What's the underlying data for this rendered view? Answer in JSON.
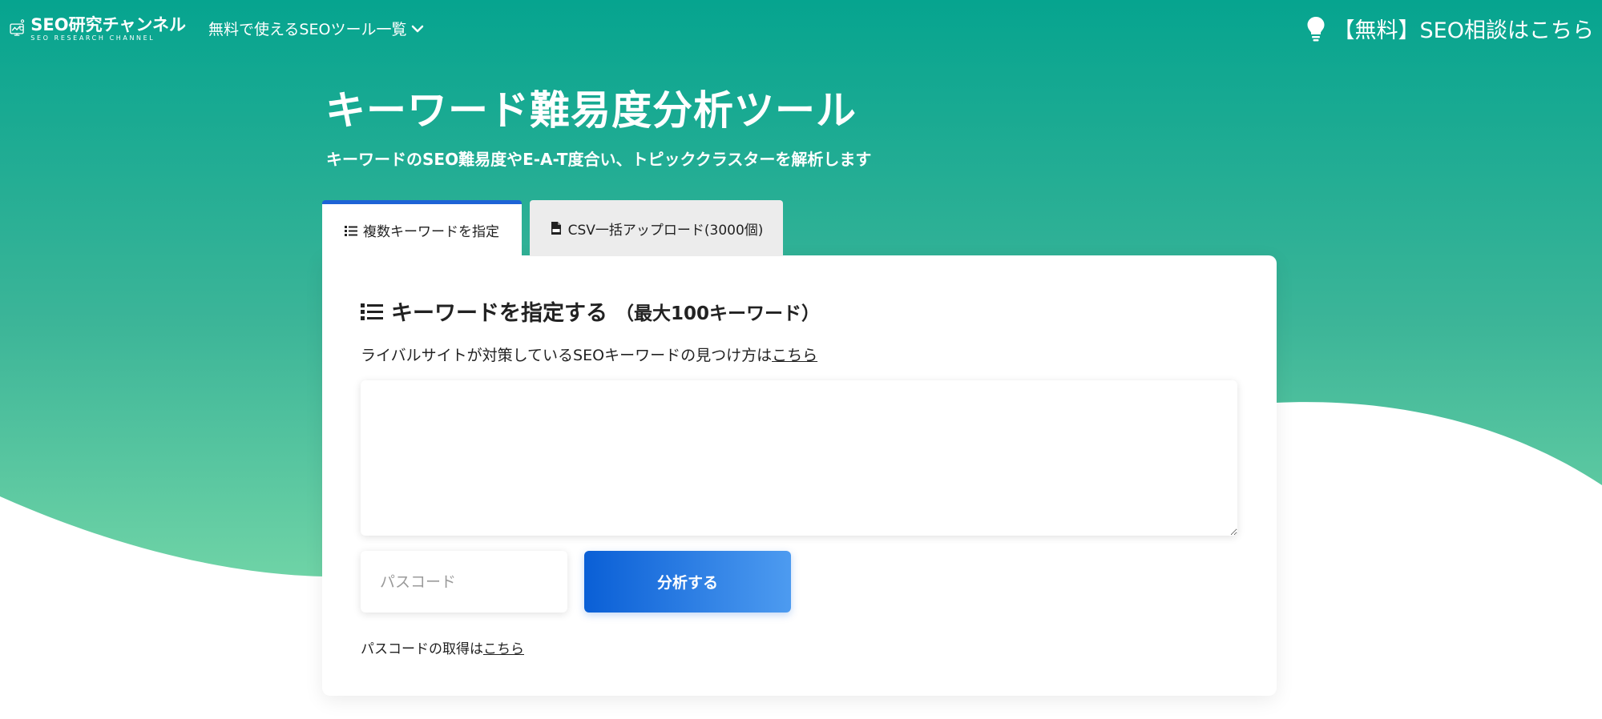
{
  "header": {
    "logo_main": "SEO研究チャンネル",
    "logo_sub": "SEO RESEARCH CHANNEL",
    "nav_tools_label": "無料で使えるSEOツール一覧",
    "consult_label": "【無料】SEO相談はこちら"
  },
  "hero": {
    "title": "キーワード難易度分析ツール",
    "subtitle": "キーワードのSEO難易度やE-A-T度合い、トピッククラスターを解析します"
  },
  "tabs": [
    {
      "label": "複数キーワードを指定",
      "icon": "list-icon",
      "active": true
    },
    {
      "label": "CSV一括アップロード(3000個)",
      "icon": "csv-file-icon",
      "active": false
    }
  ],
  "form": {
    "title": "キーワードを指定する",
    "title_note": "（最大100キーワード）",
    "hint_prefix": "ライバルサイトが対策しているSEOキーワードの見つけ方は",
    "hint_link": "こちら",
    "keywords_value": "",
    "passcode_placeholder": "パスコード",
    "passcode_value": "",
    "analyze_label": "分析する",
    "passcode_hint_prefix": "パスコードの取得は",
    "passcode_hint_link": "こちら"
  },
  "colors": {
    "brand_green": "#06a48f",
    "brand_green_light": "#6ed3a6",
    "tab_accent": "#1e63d6",
    "button_start": "#0a5fd6",
    "button_end": "#4d9bf0"
  }
}
